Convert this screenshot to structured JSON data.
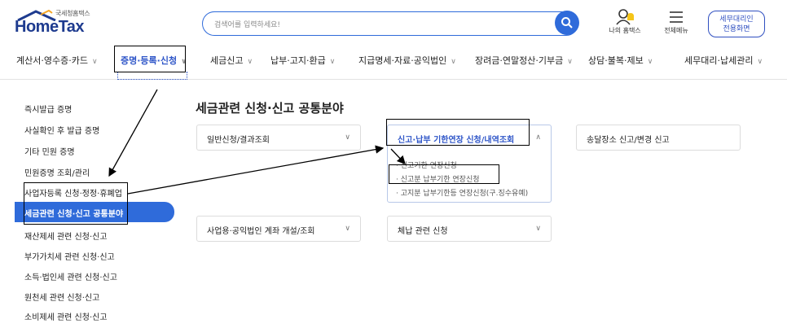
{
  "header": {
    "logo_small": "국세청홈택스",
    "logo_main": "HomeTax",
    "search_placeholder": "검색어를 입력하세요!",
    "my_home": "나의 홈택스",
    "all_menu": "전체메뉴",
    "agent_line1": "세무대리인",
    "agent_line2": "전용화면"
  },
  "nav": {
    "items": [
      {
        "label": "계산서·영수증·카드"
      },
      {
        "label": "증명·등록·신청"
      },
      {
        "label": "세금신고"
      },
      {
        "label": "납부·고지·환급"
      },
      {
        "label": "지급명세·자료·공익법인"
      },
      {
        "label": "장려금·연말정산·기부금"
      },
      {
        "label": "상담·불복·제보"
      },
      {
        "label": "세무대리·납세관리"
      }
    ]
  },
  "sidebar": {
    "items": [
      {
        "label": "즉시발급 증명"
      },
      {
        "label": "사실확인 후 발급 증명"
      },
      {
        "label": "기타 민원 증명"
      },
      {
        "label": "민원증명 조회/관리"
      },
      {
        "label": "사업자등록 신청·정정·휴폐업"
      },
      {
        "label": "세금관련 신청·신고 공통분야"
      },
      {
        "label": "재산제세 관련 신청·신고"
      },
      {
        "label": "부가가치세 관련 신청·신고"
      },
      {
        "label": "소득·법인세 관련 신청·신고"
      },
      {
        "label": "원천세 관련 신청·신고"
      },
      {
        "label": "소비제세 관련 신청·신고"
      }
    ]
  },
  "main": {
    "title": "세금관련 신청·신고 공통분야",
    "cards": [
      {
        "label": "일반신청/결과조회"
      },
      {
        "label": "신고·납부 기한연장 신청/내역조회"
      },
      {
        "label": "송달장소 신고/변경 신고"
      },
      {
        "label": "사업용·공익법인 계좌 개설/조회"
      },
      {
        "label": "체납 관련 신청"
      }
    ],
    "submenu": [
      {
        "label": "· 신고기한 연장신청"
      },
      {
        "label": "· 신고분 납부기한 연장신청"
      },
      {
        "label": "· 고지분 납부기한등 연장신청(구.징수유예)"
      }
    ]
  },
  "colors": {
    "accent": "#2f6bda",
    "brand": "#1e3b8f"
  }
}
